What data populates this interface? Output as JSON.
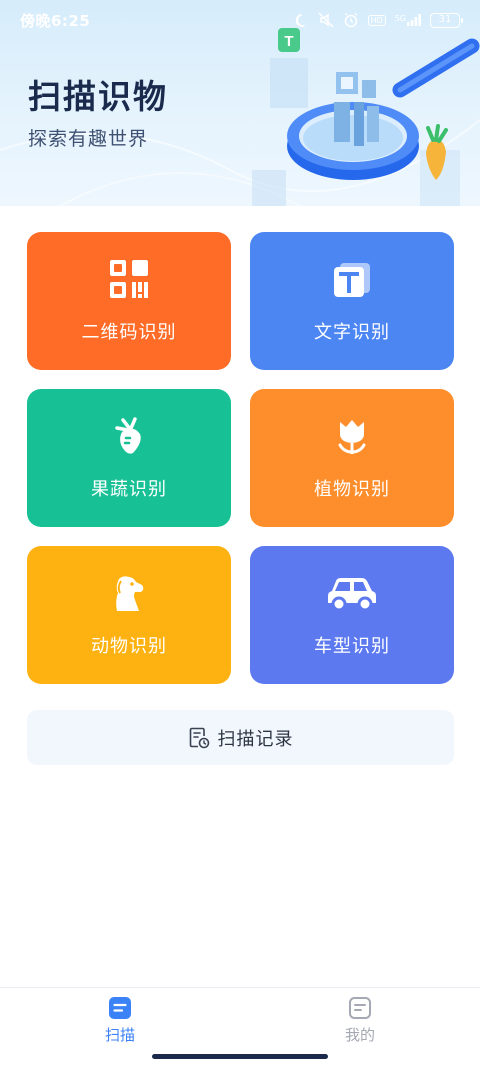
{
  "status_bar": {
    "time": "傍晚6:25",
    "battery": "31",
    "network": "5G",
    "hd": "HD"
  },
  "hero": {
    "title": "扫描识物",
    "subtitle": "探索有趣世界"
  },
  "features": [
    {
      "label": "二维码识别",
      "icon": "qr-code-icon",
      "color": "#fe6c27"
    },
    {
      "label": "文字识别",
      "icon": "text-icon",
      "color": "#4c86f3"
    },
    {
      "label": "果蔬识别",
      "icon": "carrot-icon",
      "color": "#17c195"
    },
    {
      "label": "植物识别",
      "icon": "tulip-icon",
      "color": "#fe8e2c"
    },
    {
      "label": "动物识别",
      "icon": "dog-icon",
      "color": "#fdb212"
    },
    {
      "label": "车型识别",
      "icon": "car-icon",
      "color": "#5d79ef"
    }
  ],
  "record": {
    "label": "扫描记录",
    "icon": "history-document-icon"
  },
  "tabbar": {
    "items": [
      {
        "label": "扫描",
        "icon": "scan-tab-icon",
        "active": true,
        "color": "#3b82f6"
      },
      {
        "label": "我的",
        "icon": "profile-tab-icon",
        "active": false,
        "color": "#a3a8b2"
      }
    ]
  }
}
